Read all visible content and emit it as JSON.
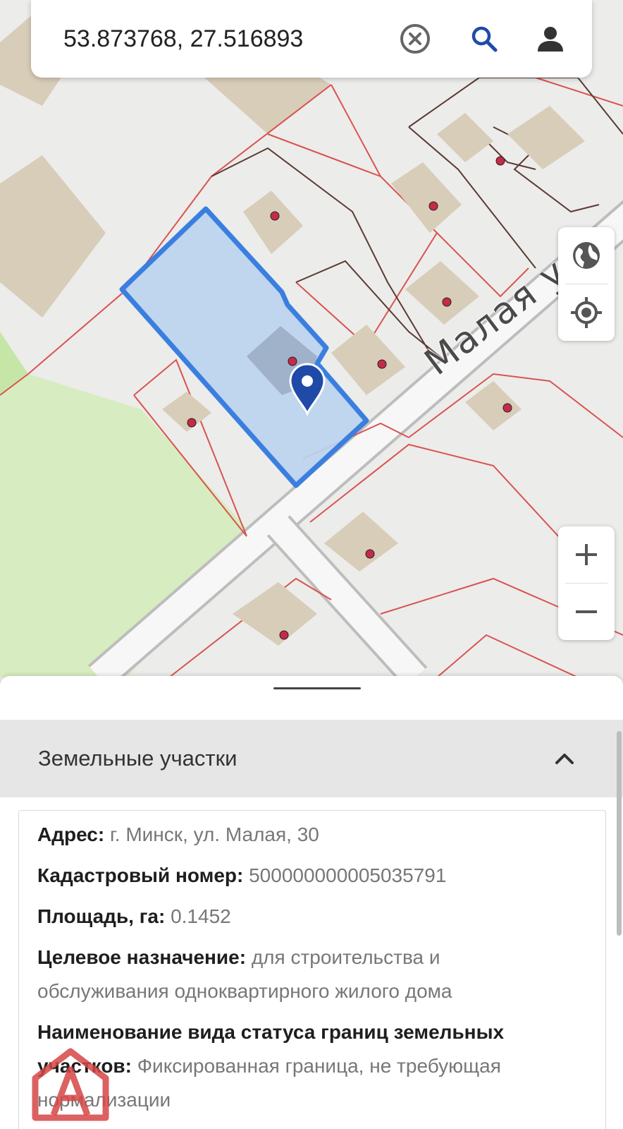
{
  "search": {
    "value": "53.873768, 27.516893"
  },
  "map": {
    "street_label": "Малая ул"
  },
  "controls": {
    "layers": "globe-icon",
    "locate": "crosshair-icon",
    "zoom_in": "+",
    "zoom_out": "−"
  },
  "sheet": {
    "section_title": "Земельные участки",
    "fields": [
      {
        "label": "Адрес:",
        "value": "г. Минск, ул. Малая, 30"
      },
      {
        "label": "Кадастровый номер:",
        "value": "500000000005035791"
      },
      {
        "label": "Площадь, га:",
        "value": "0.1452"
      },
      {
        "label": "Целевое назначение:",
        "value": "для строительства и обслуживания одноквартирного жилого дома"
      },
      {
        "label": "Наименование вида статуса границ земельных участков:",
        "value": "Фиксированная граница, не требующая нормализации"
      }
    ]
  },
  "colors": {
    "accent": "#1f4aa8",
    "parcel_fill": "#bcd3ee",
    "parcel_border": "#3a7fe0",
    "boundary_red": "#d9534f",
    "building": "#d8cdb8",
    "greenery": "#d7ecc0",
    "watermark": "#d64545"
  }
}
